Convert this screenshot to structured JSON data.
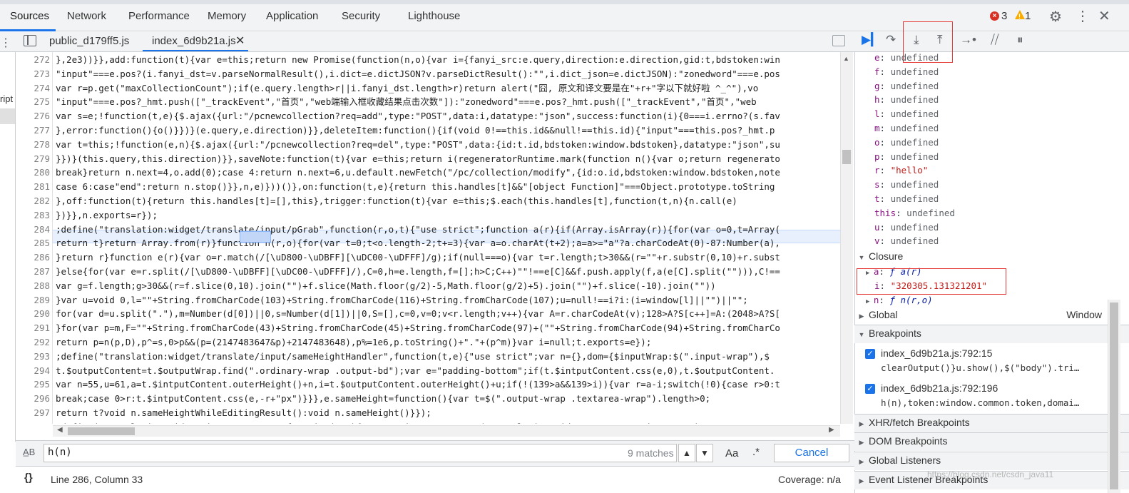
{
  "top_tabs": [
    "Sources",
    "Network",
    "Performance",
    "Memory",
    "Application",
    "Security",
    "Lighthouse"
  ],
  "error_count": "3",
  "warning_count": "1",
  "file_tabs": {
    "tab1": "public_d179ff5.js",
    "tab2": "index_6d9b21a.js"
  },
  "left_nav_text": "ript",
  "code_lines": [
    {
      "num": "272",
      "text": "},2e3))}},add:function(t){var e=this;return new Promise(function(n,o){var i={fanyi_src:e.query,direction:e.direction,gid:t,bdstoken:win"
    },
    {
      "num": "273",
      "text": "\"input\"===e.pos?(i.fanyi_dst=v.parseNormalResult(),i.dict=e.dictJSON?v.parseDictResult():\"\",i.dict_json=e.dictJSON):\"zonedword\"===e.pos"
    },
    {
      "num": "274",
      "text": "var r=p.get(\"maxCollectionCount\");if(e.query.length>r||i.fanyi_dst.length>r)return alert(\"囧, 原文和译文要是在\"+r+\"字以下就好啦 ^_^\"),vo"
    },
    {
      "num": "275",
      "text": "\"input\"===e.pos?_hmt.push([\"_trackEvent\",\"首页\",\"web端输入框收藏结果点击次数\"]):\"zonedword\"===e.pos?_hmt.push([\"_trackEvent\",\"首页\",\"web"
    },
    {
      "num": "276",
      "text": "var s=e;!function(t,e){$.ajax({url:\"/pcnewcollection?req=add\",type:\"POST\",data:i,datatype:\"json\",success:function(i){0===i.errno?(s.fav"
    },
    {
      "num": "277",
      "text": "},error:function(){o()}})}(e.query,e.direction)}},deleteItem:function(){if(void 0!==this.id&&null!==this.id){\"input\"===this.pos?_hmt.p"
    },
    {
      "num": "278",
      "text": "var t=this;!function(e,n){$.ajax({url:\"/pcnewcollection?req=del\",type:\"POST\",data:{id:t.id,bdstoken:window.bdstoken},datatype:\"json\",su"
    },
    {
      "num": "279",
      "text": "}})}(this.query,this.direction)}},saveNote:function(t){var e=this;return i(regeneratorRuntime.mark(function n(){var o;return regenerato"
    },
    {
      "num": "280",
      "text": "break}return n.next=4,o.add(0);case 4:return n.next=6,u.default.newFetch(\"/pc/collection/modify\",{id:o.id,bdstoken:window.bdstoken,note"
    },
    {
      "num": "281",
      "text": "case 6:case\"end\":return n.stop()}},n,e)}))()},on:function(t,e){return this.handles[t]&&\"[object Function]\"===Object.prototype.toString"
    },
    {
      "num": "282",
      "text": "},off:function(t){return this.handles[t]=[],this},trigger:function(t){var e=this;$.each(this.handles[t],function(t,n){n.call(e)"
    },
    {
      "num": "283",
      "text": "})}},n.exports=r});"
    },
    {
      "num": "284",
      "text": ";define(\"translation:widget/translate/input/pGrab\",function(r,o,t){\"use strict\";function a(r){if(Array.isArray(r)){for(var o=0,t=Array("
    },
    {
      "num": "285",
      "text": "return t}return Array.from(r)}function n(r,o){for(var t=0;t<o.length-2;t+=3){var a=o.charAt(t+2);a=a>=\"a\"?a.charCodeAt(0)-87:Number(a),"
    },
    {
      "num": "286",
      "text": "}return r}function e(r){var o=r.match(/[\\uD800-\\uDBFF][\\uDC00-\\uDFFF]/g);if(null===o){var t=r.length;t>30&&(r=\"\"+r.substr(0,10)+r.subst"
    },
    {
      "num": "287",
      "text": "}else{for(var e=r.split(/[\\uD800-\\uDBFF][\\uDC00-\\uDFFF]/),C=0,h=e.length,f=[];h>C;C++)\"\"!==e[C]&&f.push.apply(f,a(e[C].split(\"\"))),C!=="
    },
    {
      "num": "288",
      "text": "var g=f.length;g>30&&(r=f.slice(0,10).join(\"\")+f.slice(Math.floor(g/2)-5,Math.floor(g/2)+5).join(\"\")+f.slice(-10).join(\"\"))"
    },
    {
      "num": "289",
      "text": "}var u=void 0,l=\"\"+String.fromCharCode(103)+String.fromCharCode(116)+String.fromCharCode(107);u=null!==i?i:(i=window[l]||\"\")||\"\";"
    },
    {
      "num": "290",
      "text": "for(var d=u.split(\".\"),m=Number(d[0])||0,s=Number(d[1])||0,S=[],c=0,v=0;v<r.length;v++){var A=r.charCodeAt(v);128>A?S[c++]=A:(2048>A?S["
    },
    {
      "num": "291",
      "text": "}for(var p=m,F=\"\"+String.fromCharCode(43)+String.fromCharCode(45)+String.fromCharCode(97)+(\"\"+String.fromCharCode(94)+String.fromCharCo"
    },
    {
      "num": "292",
      "text": "return p=n(p,D),p^=s,0>p&&(p=(2147483647&p)+2147483648),p%=1e6,p.toString()+\".\"+(p^m)}var i=null;t.exports=e});"
    },
    {
      "num": "293",
      "text": ";define(\"translation:widget/translate/input/sameHeightHandler\",function(t,e){\"use strict\";var n={},dom={$inputWrap:$(\".input-wrap\"),$"
    },
    {
      "num": "294",
      "text": "t.$outputContent=t.$outputWrap.find(\".ordinary-wrap .output-bd\");var e=\"padding-bottom\";if(t.$intputContent.css(e,0),t.$outputContent."
    },
    {
      "num": "295",
      "text": "var n=55,u=61,a=t.$intputContent.outerHeight()+n,i=t.$outputContent.outerHeight()+u;if(!(139>a&&139>i)){var r=a-i;switch(!0){case r>0:t"
    },
    {
      "num": "296",
      "text": "break;case 0>r:t.$intputContent.css(e,-r+\"px\")}}},e.sameHeight=function(){var t=$(\".output-wrap .textarea-wrap\").length>0;"
    },
    {
      "num": "297",
      "text": "return t?void n.sameHeightWhileEditingResult():void n.sameHeight()}});"
    },
    {
      "num": "298",
      "text": ";define(\"translation:widget/input/correct\",function(t,r){\"use strict\";var e,n=t(\"translation:widget/common/environment\"),c=t"
    },
    {
      "num": "299",
      "text": "\"https:\"===location.protocol&&(i=\"https://correctxt.baidu.com/correctxt?callback=?\");var s={tpl:['<span class=\"correct-text\">您是不是要"
    },
    {
      "num": "300",
      "text": "},hideCorrect:function(){$(\".trans-correct\").hide()},isQueryInCheck:function(){return n.get(\"queryInCheck\")},isEnglishQuery:function(t"
    },
    {
      "num": "301",
      "text": ""
    }
  ],
  "search": {
    "value": "h(n)",
    "matches": "9 matches",
    "case_label": "Aa",
    "regex_label": ".*",
    "cancel_label": "Cancel"
  },
  "status": {
    "braces": "{}",
    "position": "Line 286, Column 33",
    "coverage": "Coverage: n/a"
  },
  "scope_locals": [
    {
      "key": "e",
      "val": "undefined"
    },
    {
      "key": "f",
      "val": "undefined"
    },
    {
      "key": "g",
      "val": "undefined"
    },
    {
      "key": "h",
      "val": "undefined"
    },
    {
      "key": "l",
      "val": "undefined"
    },
    {
      "key": "m",
      "val": "undefined"
    },
    {
      "key": "o",
      "val": "undefined"
    },
    {
      "key": "p",
      "val": "undefined"
    },
    {
      "key": "r",
      "val": "\"hello\""
    },
    {
      "key": "s",
      "val": "undefined"
    },
    {
      "key": "t",
      "val": "undefined"
    },
    {
      "key": "this",
      "val": "undefined"
    },
    {
      "key": "u",
      "val": "undefined"
    },
    {
      "key": "v",
      "val": "undefined"
    }
  ],
  "closure": {
    "label": "Closure",
    "a_key": "a",
    "a_val": "ƒ a(r)",
    "i_key": "i",
    "i_val": "\"320305.131321201\"",
    "n_key": "n",
    "n_val": "ƒ n(r,o)"
  },
  "global": {
    "label": "Global",
    "value": "Window"
  },
  "breakpoints": {
    "label": "Breakpoints",
    "items": [
      {
        "file": "index_6d9b21a.js:792:15",
        "code": "clearOutput()}u.show(),$(\"body\").tri…"
      },
      {
        "file": "index_6d9b21a.js:792:196",
        "code": "h(n),token:window.common.token,domai…"
      }
    ]
  },
  "sections": [
    "XHR/fetch Breakpoints",
    "DOM Breakpoints",
    "Global Listeners",
    "Event Listener Breakpoints"
  ],
  "watermark": "https://blog.csdn.net/csdn_java11"
}
